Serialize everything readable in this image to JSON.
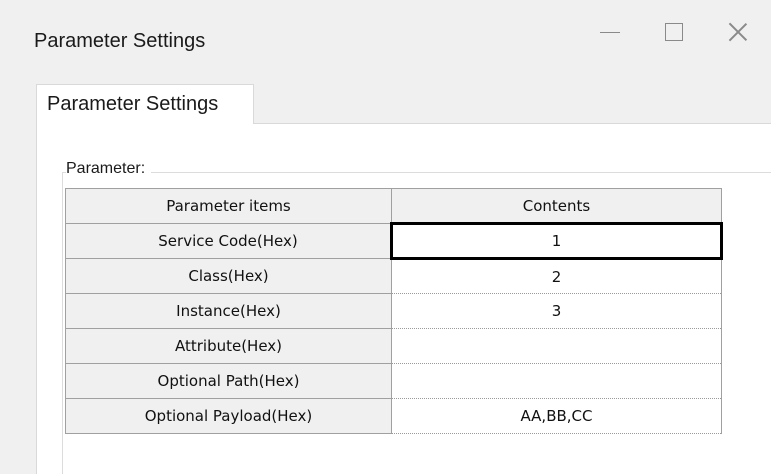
{
  "window": {
    "title": "Parameter Settings",
    "controls": {
      "minimize": "minimize-icon",
      "maximize": "maximize-icon",
      "close": "close-icon"
    }
  },
  "tab": {
    "label": "Parameter Settings"
  },
  "group": {
    "label": "Parameter:"
  },
  "table": {
    "headers": [
      "Parameter items",
      "Contents"
    ],
    "rows": [
      {
        "item": "Service Code(Hex)",
        "value": "1"
      },
      {
        "item": "Class(Hex)",
        "value": "2"
      },
      {
        "item": "Instance(Hex)",
        "value": "3"
      },
      {
        "item": "Attribute(Hex)",
        "value": ""
      },
      {
        "item": "Optional Path(Hex)",
        "value": ""
      },
      {
        "item": "Optional Payload(Hex)",
        "value": "AA,BB,CC"
      }
    ]
  }
}
